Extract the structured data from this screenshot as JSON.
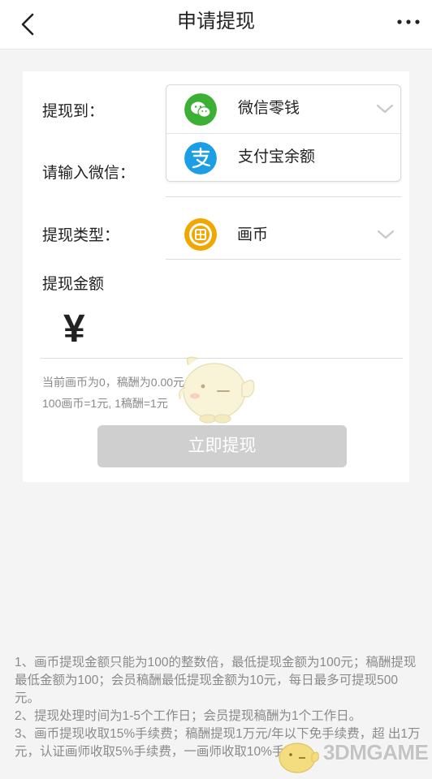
{
  "header": {
    "title": "申请提现"
  },
  "form": {
    "withdraw_to_label": "提现到：",
    "wechat_input_label": "请输入微信：",
    "options": [
      {
        "label": "微信零钱",
        "icon": "wechat-icon",
        "color": "#3cb035"
      },
      {
        "label": "支付宝余额",
        "icon": "alipay-icon",
        "color": "#1b9ee6"
      }
    ],
    "type_label": "提现类型：",
    "type_value": "画币",
    "type_icon_color": "#f0a800",
    "amount_label": "提现金额",
    "currency_symbol": "¥",
    "amount_value": "",
    "balance_hint": "当前画币为0，稿酬为0.00元",
    "rate_hint": "100画币=1元, 1稿酬=1元",
    "submit_label": "立即提现"
  },
  "notes": [
    "1、画币提现金额只能为100的整数倍，最低提现金额为100元；稿酬提现最低金额为100；会员稿酬最低提现金额为10元，每日最多可提现500元。",
    " 2、提现处理时间为1-5个工作日；会员提现稿酬为1个工作日。",
    " 3、画币提现收取15%手续费；稿酬提现1万元/年以下免手续费，超 出1万元，认证画师收取5%手续费，一画师收取10%手续费。"
  ],
  "watermark": "3DMGAME"
}
